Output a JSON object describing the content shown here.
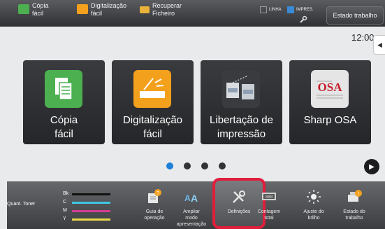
{
  "top_bar": {
    "shortcuts": [
      {
        "label": "Cópia\nfácil",
        "icon": "copy-icon",
        "color": "#4caf50"
      },
      {
        "label": "Digitalização\nfácil",
        "icon": "scan-icon",
        "color": "#f3a11d"
      },
      {
        "label": "Recuperar\nFicheiro",
        "icon": "folder-icon",
        "color": "#e9b23a"
      }
    ],
    "indicator_linha": "LINHA",
    "indicator_impres": "IMPRES.",
    "status_button": "Estado trabalho"
  },
  "clock": "12:00",
  "tiles": [
    {
      "label": "Cópia\nfácil",
      "icon": "copy-icon",
      "color": "#4caf50"
    },
    {
      "label": "Digitalização\nfácil",
      "icon": "scan-icon",
      "color": "#f3a11d"
    },
    {
      "label": "Libertação de\nimpressão",
      "icon": "print-release-icon",
      "color": "#d9dde2"
    },
    {
      "label": "Sharp OSA",
      "icon": "sharp-osa-icon",
      "color": "#e5e5e5"
    }
  ],
  "pager": {
    "pages": 4,
    "current": 1
  },
  "toner": {
    "label": "Quant. Toner",
    "channels": [
      {
        "name": "Bk",
        "color": "#111111",
        "level": 0.9
      },
      {
        "name": "C",
        "color": "#3fc7e3",
        "level": 0.9
      },
      {
        "name": "M",
        "color": "#d53c93",
        "level": 0.9
      },
      {
        "name": "Y",
        "color": "#e9d84a",
        "level": 0.9
      }
    ]
  },
  "bottom_buttons": [
    {
      "label": "Guia de\noperação",
      "icon": "operation-guide-icon"
    },
    {
      "label": "Ampliar\nmodo\napresentação",
      "icon": "display-zoom-icon"
    },
    {
      "label": "Definições",
      "icon": "settings-icon"
    },
    {
      "label": "Contagem\ntotal",
      "icon": "total-count-icon"
    },
    {
      "label": "Ajuste do\nbrilho",
      "icon": "brightness-icon"
    },
    {
      "label": "Estado do\ntrabalho",
      "icon": "job-status-icon"
    }
  ],
  "accent_colors": {
    "highlight": "#e01e3c"
  }
}
